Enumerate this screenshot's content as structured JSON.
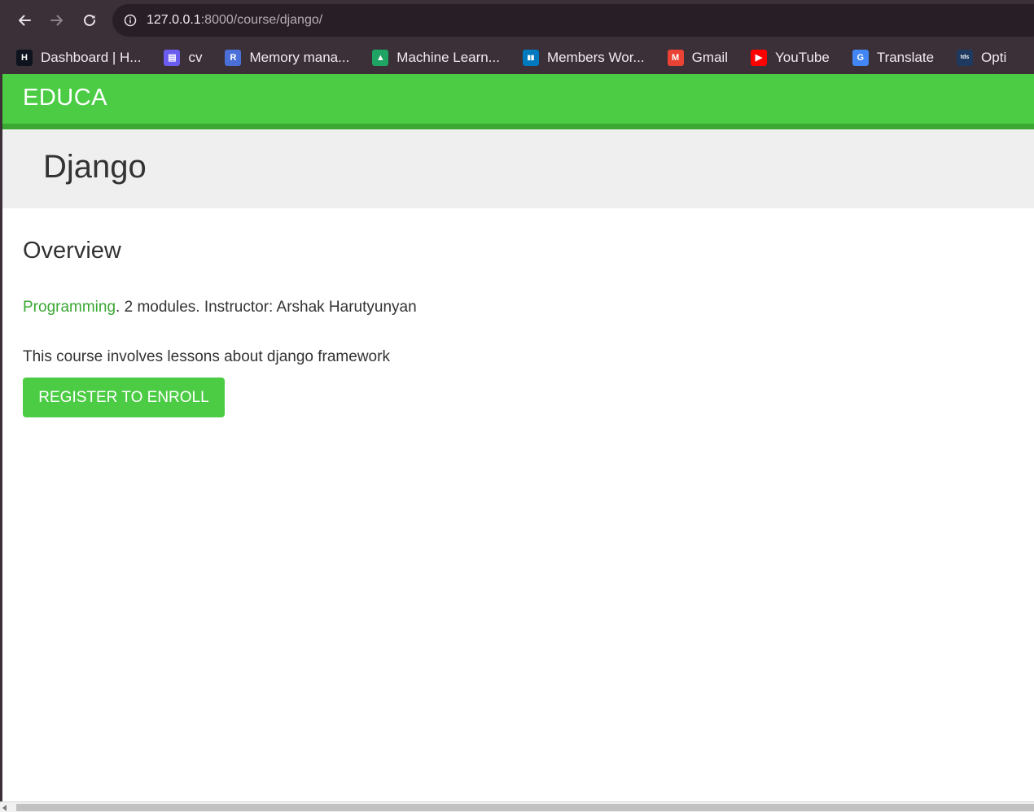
{
  "browser": {
    "url_host": "127.0.0.1",
    "url_rest": ":8000/course/django/",
    "bookmarks": [
      {
        "label": "Dashboard | H...",
        "icon": "hackerrank-icon",
        "color": "#0e141e"
      },
      {
        "label": "cv",
        "icon": "document-icon",
        "color": "#6b5cf0"
      },
      {
        "label": "Memory mana...",
        "icon": "r-logo-icon",
        "color": "#4a6fd8"
      },
      {
        "label": "Machine Learn...",
        "icon": "google-drive-icon",
        "color": "#1fa463"
      },
      {
        "label": "Members Wor...",
        "icon": "trello-icon",
        "color": "#0079bf"
      },
      {
        "label": "Gmail",
        "icon": "gmail-icon",
        "color": "#ea4335"
      },
      {
        "label": "YouTube",
        "icon": "youtube-icon",
        "color": "#ff0000"
      },
      {
        "label": "Translate",
        "icon": "google-translate-icon",
        "color": "#4285f4"
      },
      {
        "label": "Opti",
        "icon": "tds-icon",
        "color": "#1e3a5f"
      }
    ]
  },
  "site": {
    "logo": "EDUCA",
    "brand_color": "#4ccc45"
  },
  "course": {
    "title": "Django",
    "overview_heading": "Overview",
    "subject": "Programming",
    "meta_rest": ". 2 modules. Instructor: Arshak Harutyunyan",
    "description": "This course involves lessons about django framework",
    "enroll_label": "REGISTER TO ENROLL"
  }
}
